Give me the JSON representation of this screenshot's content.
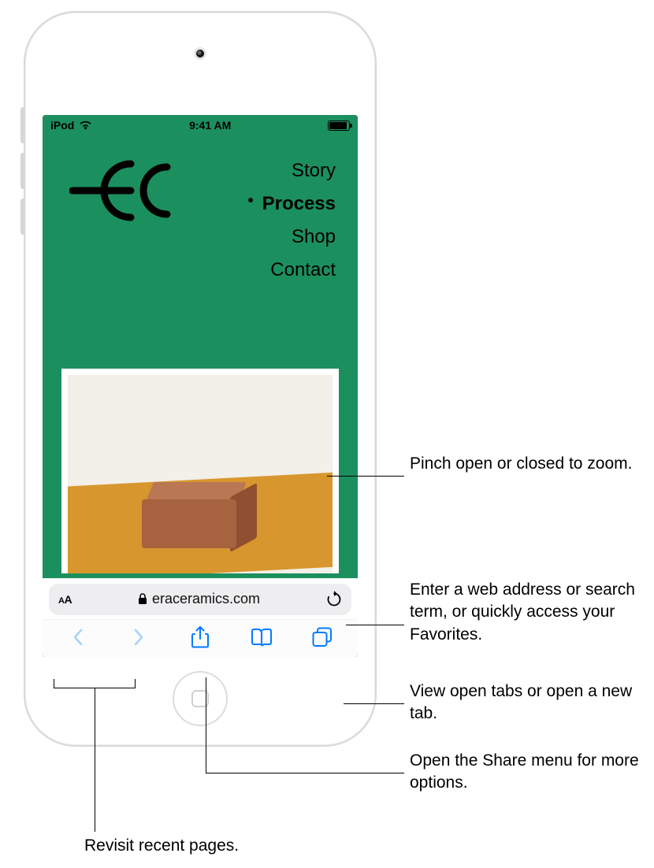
{
  "status_bar": {
    "device_label": "iPod",
    "time": "9:41 AM"
  },
  "website": {
    "nav": {
      "story": "Story",
      "process": "Process",
      "shop": "Shop",
      "contact": "Contact"
    }
  },
  "address_bar": {
    "url": "eraceramics.com"
  },
  "callouts": {
    "zoom": "Pinch open or closed to zoom.",
    "address": "Enter a web address or search term, or quickly access your Favorites.",
    "tabs": "View open tabs or open a new tab.",
    "share": "Open the Share menu for more options.",
    "history": "Revisit recent pages."
  }
}
